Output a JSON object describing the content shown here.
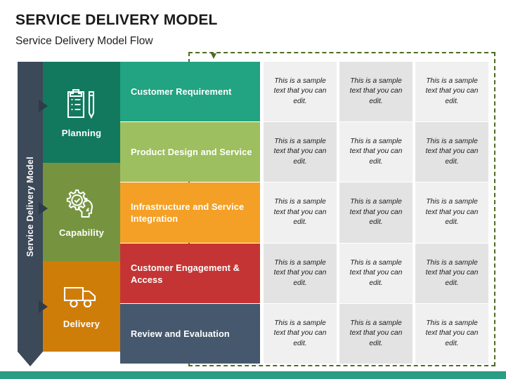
{
  "header": {
    "title": "SERVICE DELIVERY MODEL",
    "subtitle": "Service Delivery Model Flow"
  },
  "spine": {
    "label": "Service Delivery Model",
    "color": "#3b4959"
  },
  "categories": [
    {
      "label": "Planning",
      "icon": "clipboard-pen-icon",
      "color": "#12795f"
    },
    {
      "label": "Capability",
      "icon": "gear-head-icon",
      "color": "#769440"
    },
    {
      "label": "Delivery",
      "icon": "delivery-truck-icon",
      "color": "#cf7d09"
    }
  ],
  "rows": [
    {
      "label": "Customer Requirement",
      "color": "#22a382"
    },
    {
      "label": "Product Design and Service",
      "color": "#9dbf5f"
    },
    {
      "label": "Infrastructure and Service Integration",
      "color": "#f4a026"
    },
    {
      "label": "Customer Engagement & Access",
      "color": "#c53434"
    },
    {
      "label": "Review and Evaluation",
      "color": "#45586e"
    }
  ],
  "grid": {
    "columns": 3,
    "cells": [
      [
        "This is a sample text that you can edit.",
        "This is a sample text that you can edit.",
        "This is a sample text that you can edit."
      ],
      [
        "This is a sample text that you can edit.",
        "This is a sample text that you can edit.",
        "This is a sample text that you can edit."
      ],
      [
        "This is a sample text that you can edit.",
        "This is a sample text that you can edit.",
        "This is a sample text that you can edit."
      ],
      [
        "This is a sample text that you can edit.",
        "This is a sample text that you can edit.",
        "This is a sample text that you can edit."
      ],
      [
        "This is a sample text that you can edit.",
        "This is a sample text that you can edit.",
        "This is a sample text that you can edit."
      ]
    ],
    "cell_color_light": "#f0f0f0",
    "cell_color_dark": "#e3e3e3"
  },
  "decoration": {
    "dashed_border_color": "#4e6b21",
    "bottom_bar_color": "#2a9d82"
  }
}
